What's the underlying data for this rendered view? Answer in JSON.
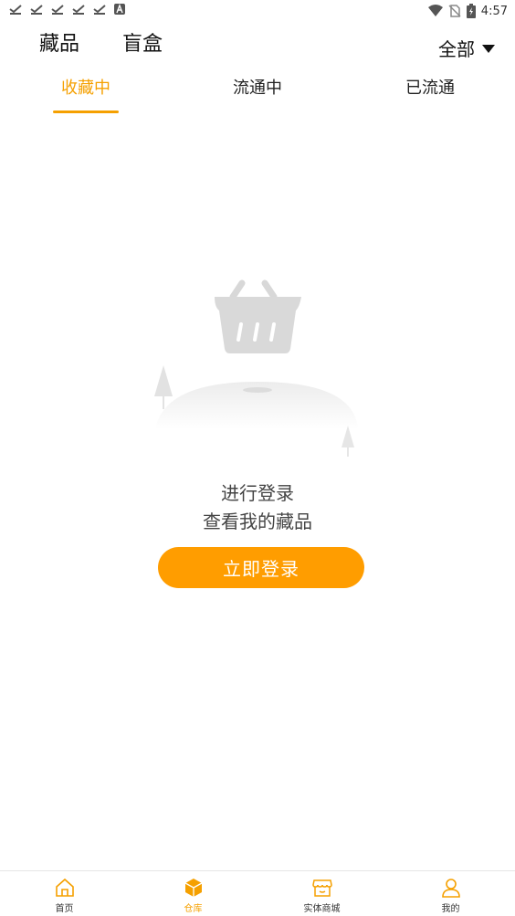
{
  "status_bar": {
    "time": "4:57"
  },
  "header": {
    "tabs": [
      {
        "label": "藏品"
      },
      {
        "label": "盲盒"
      }
    ],
    "filter_label": "全部"
  },
  "subtabs": [
    {
      "label": "收藏中",
      "active": true
    },
    {
      "label": "流通中",
      "active": false
    },
    {
      "label": "已流通",
      "active": false
    }
  ],
  "empty_state": {
    "line1": "进行登录",
    "line2": "查看我的藏品",
    "button_label": "立即登录"
  },
  "bottom_nav": [
    {
      "label": "首页",
      "icon": "home-icon"
    },
    {
      "label": "仓库",
      "icon": "box-icon",
      "active": true
    },
    {
      "label": "实体商城",
      "icon": "store-icon"
    },
    {
      "label": "我的",
      "icon": "user-icon"
    }
  ],
  "colors": {
    "accent": "#f5a000",
    "button": "#ff9d00"
  }
}
